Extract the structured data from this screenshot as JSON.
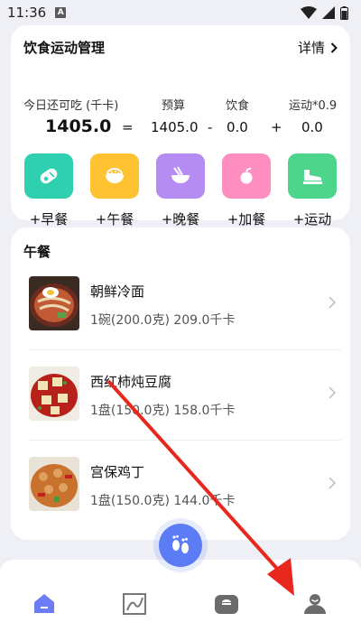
{
  "status_bar": {
    "time": "11:36",
    "notification_letter": "A"
  },
  "summary": {
    "title": "饮食运动管理",
    "detail_label": "详情",
    "labels": {
      "remaining": "今日还可吃 (千卡)",
      "budget": "预算",
      "diet": "饮食",
      "exercise": "运动*0.9"
    },
    "values": {
      "remaining": "1405.0",
      "eq": "=",
      "budget": "1405.0",
      "minus": "-",
      "diet": "0.0",
      "plus": "+",
      "exercise": "0.0"
    },
    "actions": [
      {
        "label": "+早餐",
        "icon": "breakfast-icon",
        "color": "#2fd0b0"
      },
      {
        "label": "+午餐",
        "icon": "lunch-icon",
        "color": "#ffc233"
      },
      {
        "label": "+晚餐",
        "icon": "dinner-icon",
        "color": "#b48cf2"
      },
      {
        "label": "+加餐",
        "icon": "snack-icon",
        "color": "#ff8ec0"
      },
      {
        "label": "+运动",
        "icon": "exercise-icon",
        "color": "#4dd58b"
      }
    ]
  },
  "meal": {
    "title": "午餐",
    "items": [
      {
        "name": "朝鲜冷面",
        "detail": "1碗(200.0克) 209.0千卡"
      },
      {
        "name": "西红柿炖豆腐",
        "detail": "1盘(150.0克) 158.0千卡"
      },
      {
        "name": "宫保鸡丁",
        "detail": "1盘(150.0克) 144.0千卡"
      }
    ]
  },
  "nav": [
    "home-icon",
    "chart-icon",
    "recipe-icon",
    "profile-icon"
  ],
  "colors": {
    "accent": "#5b7cf5",
    "arrow": "#e8281e"
  }
}
